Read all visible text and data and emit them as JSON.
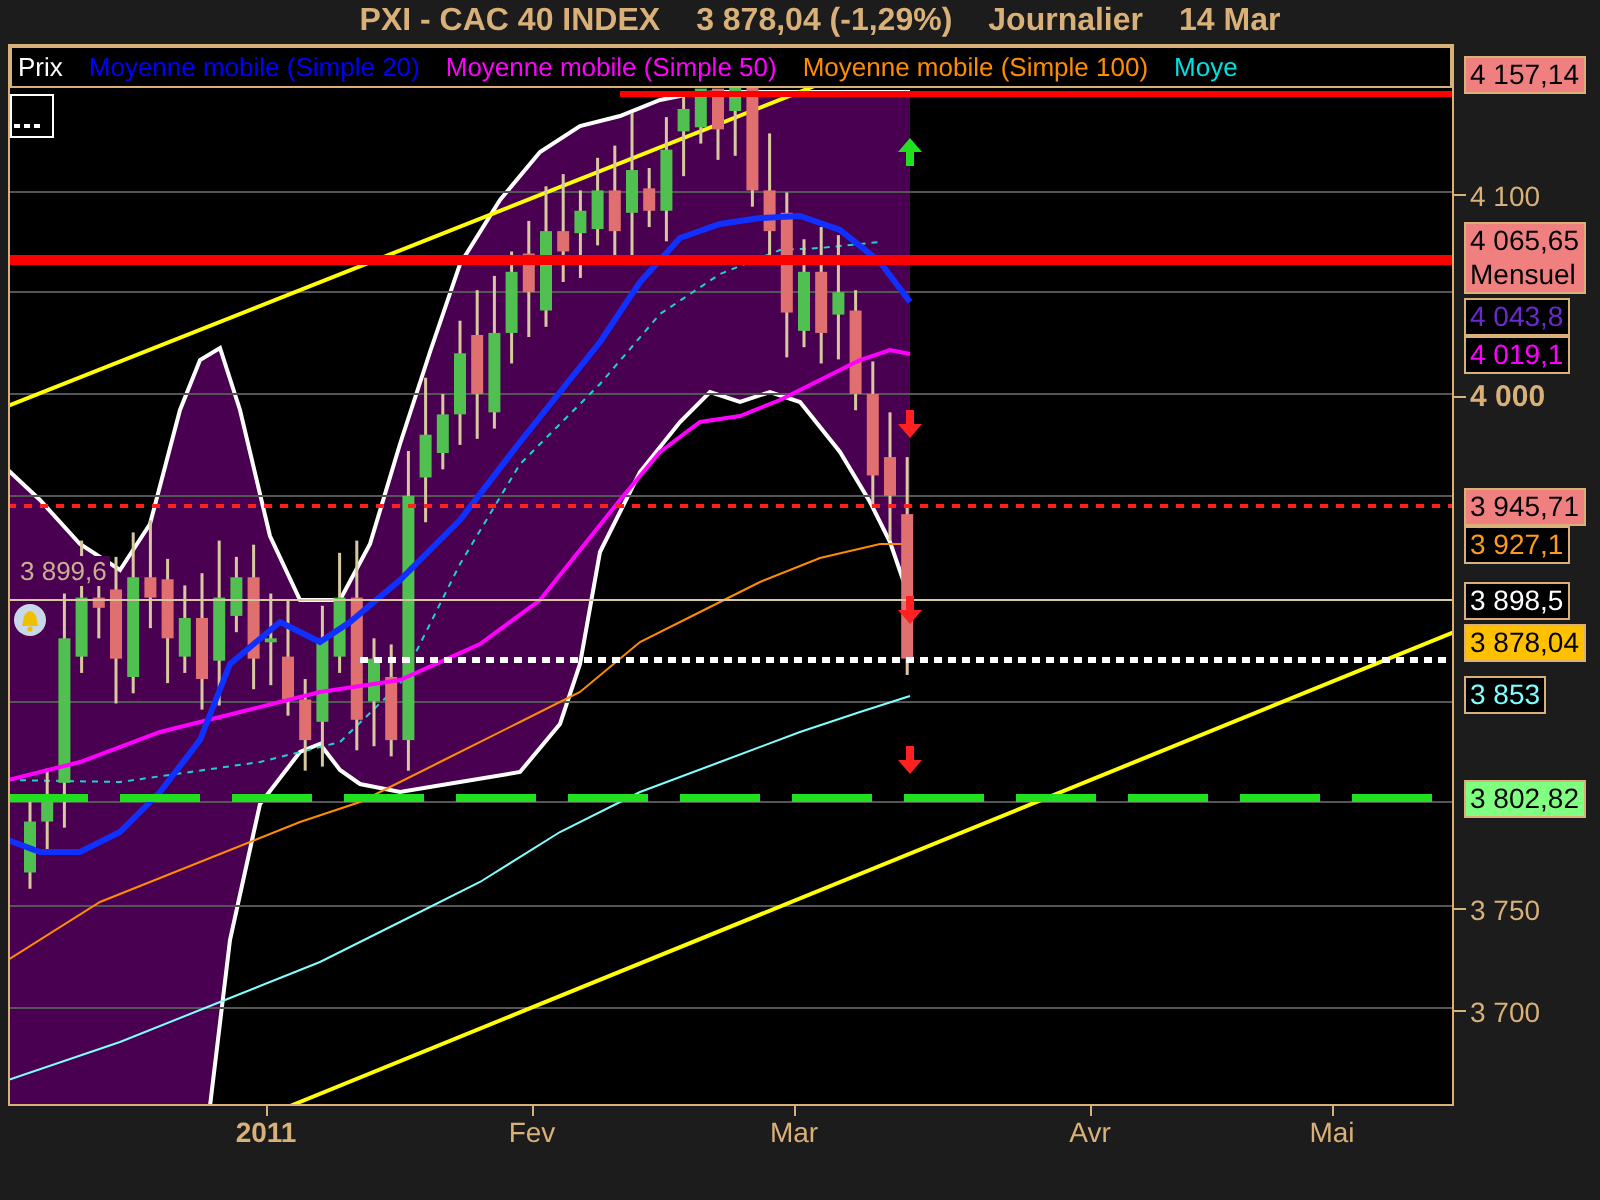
{
  "header": {
    "title": "PXI - CAC 40 INDEX",
    "price": "3 878,04 (-1,29%)",
    "period": "Journalier",
    "date": "14 Mar"
  },
  "legend": [
    {
      "label": "Prix",
      "color": "#ffffff"
    },
    {
      "label": "Moyenne mobile (Simple 20)",
      "color": "#0000ff"
    },
    {
      "label": "Moyenne mobile (Simple 50)",
      "color": "#ff00ff"
    },
    {
      "label": "Moyenne mobile (Simple 100)",
      "color": "#ff8c00"
    },
    {
      "label": "Moye",
      "color": "#00e0e0"
    }
  ],
  "chart_labels": {
    "last_close": "3 899,6"
  },
  "price_axis": [
    {
      "kind": "tag",
      "label": "4 157,14",
      "color": "#f08080"
    },
    {
      "kind": "tick",
      "label": "4 100"
    },
    {
      "kind": "tag",
      "label": "4 065,65",
      "sublabel": "Mensuel",
      "color": "#f08080"
    },
    {
      "kind": "outline",
      "label": "4 043,8",
      "color": "#6a2ad0"
    },
    {
      "kind": "outline",
      "label": "4 019,1",
      "color": "#ff00ff"
    },
    {
      "kind": "major",
      "label": "4 000"
    },
    {
      "kind": "tag",
      "label": "3 945,71",
      "color": "#f08080"
    },
    {
      "kind": "outline",
      "label": "3 927,1",
      "color": "#ff9a20"
    },
    {
      "kind": "outline",
      "label": "3 898,5",
      "color": "#ffffff"
    },
    {
      "kind": "tag",
      "label": "3 878,04",
      "color": "#ffc000"
    },
    {
      "kind": "outline",
      "label": "3 853",
      "color": "#80ffff"
    },
    {
      "kind": "tag",
      "label": "3 802,82",
      "color": "#80ff80"
    },
    {
      "kind": "tick",
      "label": "3 750"
    },
    {
      "kind": "tick",
      "label": "3 700"
    }
  ],
  "time_axis": [
    {
      "kind": "year",
      "label": "2011"
    },
    {
      "kind": "month",
      "label": "Fev"
    },
    {
      "kind": "month",
      "label": "Mar"
    },
    {
      "kind": "month",
      "label": "Avr"
    },
    {
      "kind": "month",
      "label": "Mai"
    }
  ]
}
